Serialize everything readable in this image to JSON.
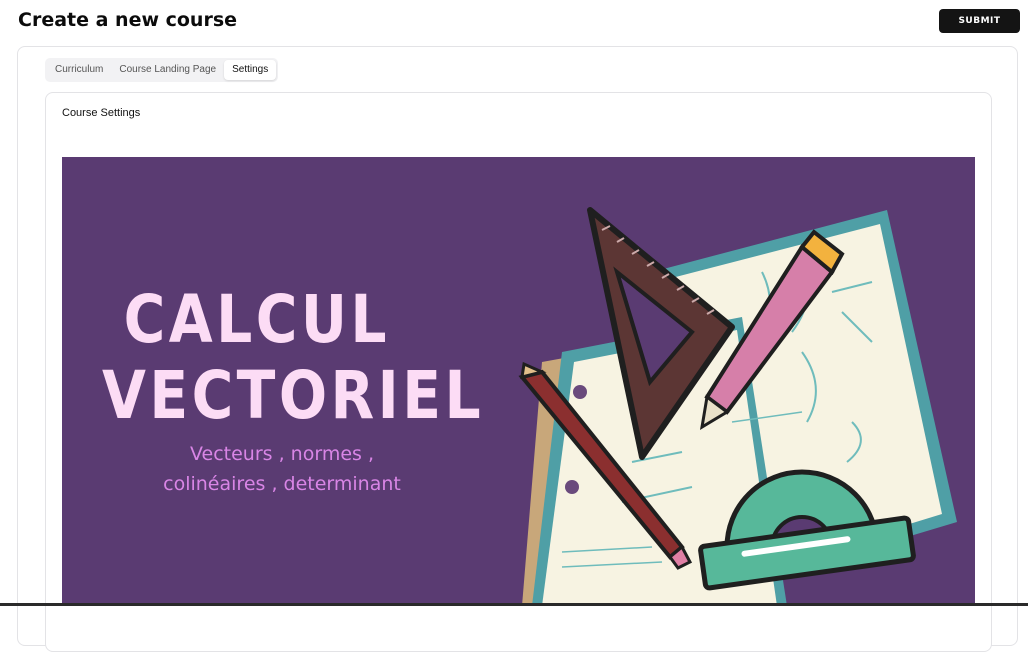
{
  "header": {
    "title": "Create a new course",
    "submit_label": "SUBMIT"
  },
  "tabs": [
    {
      "label": "Curriculum",
      "active": false
    },
    {
      "label": "Course Landing Page",
      "active": false
    },
    {
      "label": "Settings",
      "active": true
    }
  ],
  "settings": {
    "section_title": "Course Settings",
    "course_image": {
      "title_line1": "CALCUL",
      "title_line2": "VECTORIEL",
      "subtitle_line1": "Vecteurs , normes ,",
      "subtitle_line2": "colinéaires , determinant",
      "background_color": "#5a3b72",
      "title_color": "#fcdcf5",
      "subtitle_color": "#d985e6",
      "illustration_icons": [
        "set-square-icon",
        "pencil-icon",
        "pen-icon",
        "protractor-icon",
        "notebook-icon"
      ]
    }
  },
  "colors": {
    "submit_bg": "#141414",
    "border": "#e3e3e6"
  }
}
